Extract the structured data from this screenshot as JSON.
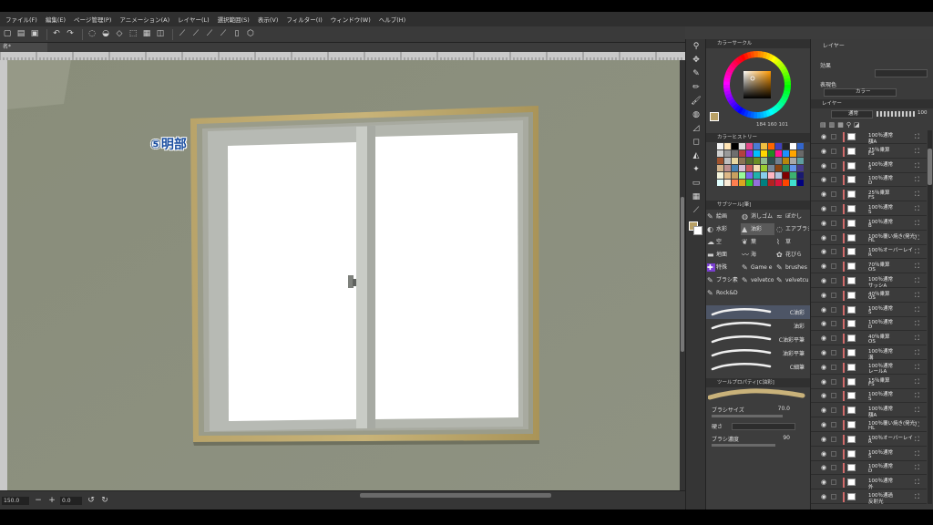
{
  "menu": [
    "ファイル(F)",
    "編集(E)",
    "ページ管理(P)",
    "アニメーション(A)",
    "レイヤー(L)",
    "選択範囲(S)",
    "表示(V)",
    "フィルター(I)",
    "ウィンドウ(W)",
    "ヘルプ(H)"
  ],
  "toolbar_icons": [
    "new-icon",
    "open-icon",
    "save-icon",
    "undo-icon",
    "redo-icon",
    "transform-icon",
    "fill-icon",
    "clear-icon",
    "select-icon",
    "ruler-icon"
  ],
  "document_tab": "名*",
  "canvas_label": "⑤明部",
  "status": {
    "zoom": "150.0",
    "angle": "0.0"
  },
  "color_panel": {
    "title": "カラーサークル",
    "rgb": [
      "184",
      "160",
      "101"
    ],
    "ring_colors": [
      "#ff0000",
      "#ffff00",
      "#00ff00",
      "#00ffff",
      "#0000ff",
      "#ff00ff"
    ],
    "main_color": "#b8a065"
  },
  "color_history": {
    "title": "カラーヒストリー",
    "swatches": [
      "#f4f4f4",
      "#ffe4b5",
      "#000000",
      "#dddddd",
      "#e24a8a",
      "#4b7bd5",
      "#f0c040",
      "#ff6600",
      "#4040c0",
      "#222222",
      "#ffffff",
      "#3366cc",
      "#cfcfcf",
      "#9a9a9a",
      "#6e6e6e",
      "#b34040",
      "#8a2be2",
      "#00bfff",
      "#ffd700",
      "#228b22",
      "#ff1493",
      "#1e90ff",
      "#ffa500",
      "#696969",
      "#a0522d",
      "#c0c0c0",
      "#e8d8a0",
      "#8b7355",
      "#556b2f",
      "#6b8e23",
      "#8fbc8f",
      "#2f4f4f",
      "#708090",
      "#b8860b",
      "#a9a9a9",
      "#5f9ea0",
      "#d2b48c",
      "#bc8f8f",
      "#4682b4",
      "#d8bfd8",
      "#cd5c5c",
      "#f5deb3",
      "#9acd32",
      "#778899",
      "#8b4513",
      "#2e8b57",
      "#6495ed",
      "#483d8b",
      "#f5f5dc",
      "#deb887",
      "#c8a060",
      "#98fb98",
      "#7b68ee",
      "#20b2aa",
      "#87ceeb",
      "#ffb6c1",
      "#b0c4de",
      "#800000",
      "#3cb371",
      "#191970",
      "#e0ffff",
      "#faebd7",
      "#ff7f50",
      "#daa520",
      "#32cd32",
      "#9370db",
      "#008080",
      "#b22222",
      "#dc143c",
      "#ff4500",
      "#40e0d0",
      "#000080"
    ]
  },
  "sub_tool": {
    "title": "サブツール[筆]",
    "tabs": [
      "絵画",
      "消しゴム",
      "ぼかし",
      "水彩",
      "油彩",
      "エアブラシ",
      "空",
      "葉",
      "草",
      "地面",
      "海",
      "花びら",
      "特殊",
      "Game e",
      "brushes",
      "ブラシ素",
      "velvetco",
      "velvetcu",
      "Rock&D"
    ],
    "strokes": [
      "C油彩",
      "油彩",
      "C油彩平筆",
      "油彩平筆",
      "C細筆"
    ]
  },
  "tool_property": {
    "title": "ツールプロパティ[C油彩]",
    "brush_size_label": "ブラシサイズ",
    "brush_size": "70.0",
    "hardness_label": "硬さ",
    "density_label": "ブラシ濃度",
    "density": "90"
  },
  "layer_panel": {
    "tab_layer": "レイヤー",
    "tab_effect": "効果",
    "expression_color_label": "表現色",
    "expression_color": "カラー",
    "blend_mode": "通常",
    "opacity": "100",
    "layers": [
      {
        "mode": "100％通常",
        "name": "額A"
      },
      {
        "mode": "25％乗算",
        "name": "FS"
      },
      {
        "mode": "100％通常",
        "name": "S"
      },
      {
        "mode": "100％通常",
        "name": "D"
      },
      {
        "mode": "25％乗算",
        "name": "FS"
      },
      {
        "mode": "100％通常",
        "name": "S"
      },
      {
        "mode": "100％通常",
        "name": "B"
      },
      {
        "mode": "100％覆い焼き(発光)",
        "name": "HL"
      },
      {
        "mode": "100％オーバーレイ",
        "name": "R"
      },
      {
        "mode": "70％乗算",
        "name": "OS"
      },
      {
        "mode": "100％通常",
        "name": "サッシA"
      },
      {
        "mode": "40％乗算",
        "name": "OS"
      },
      {
        "mode": "100％通常",
        "name": "S"
      },
      {
        "mode": "100％通常",
        "name": "D"
      },
      {
        "mode": "40％乗算",
        "name": "OS"
      },
      {
        "mode": "100％通常",
        "name": "溝"
      },
      {
        "mode": "100％通常",
        "name": "レールA"
      },
      {
        "mode": "15％乗算",
        "name": "FS"
      },
      {
        "mode": "100％通常",
        "name": "S"
      },
      {
        "mode": "100％通常",
        "name": "額A"
      },
      {
        "mode": "100％覆い焼き(発光)",
        "name": "HL"
      },
      {
        "mode": "100％オーバーレイ",
        "name": "R"
      },
      {
        "mode": "100％通常",
        "name": "S"
      },
      {
        "mode": "100％通常",
        "name": "D"
      },
      {
        "mode": "100％通常",
        "name": "外"
      },
      {
        "mode": "100％通過",
        "name": "反射光"
      }
    ]
  }
}
